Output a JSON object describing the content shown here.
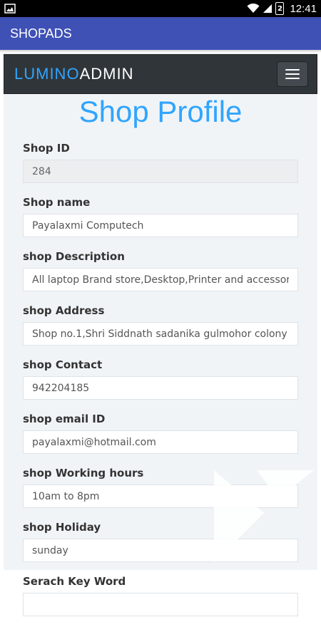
{
  "status": {
    "time": "12:41",
    "battery_level": "2"
  },
  "app": {
    "title": "SHOPADS"
  },
  "navbar": {
    "brand_part1": "LUMINO",
    "brand_part2": "ADMIN"
  },
  "page": {
    "title": "Shop Profile"
  },
  "form": {
    "fields": [
      {
        "label": "Shop ID",
        "value": "284",
        "readonly": true
      },
      {
        "label": "Shop name",
        "value": "Payalaxmi Computech"
      },
      {
        "label": "shop Description",
        "value": "All laptop Brand store,Desktop,Printer and accessories"
      },
      {
        "label": "shop Address",
        "value": "Shop no.1,Shri Siddnath sadanika gulmohor colony"
      },
      {
        "label": "shop Contact",
        "value": "942204185"
      },
      {
        "label": "shop email ID",
        "value": "payalaxmi@hotmail.com"
      },
      {
        "label": "shop Working hours",
        "value": "10am to 8pm"
      },
      {
        "label": "shop Holiday",
        "value": "sunday"
      },
      {
        "label": "Serach Key Word",
        "value": ""
      }
    ]
  },
  "colors": {
    "appbar": "#3f51b5",
    "accent": "#30a5ff",
    "navbar": "#30353a",
    "panel": "#f1f4f7"
  }
}
